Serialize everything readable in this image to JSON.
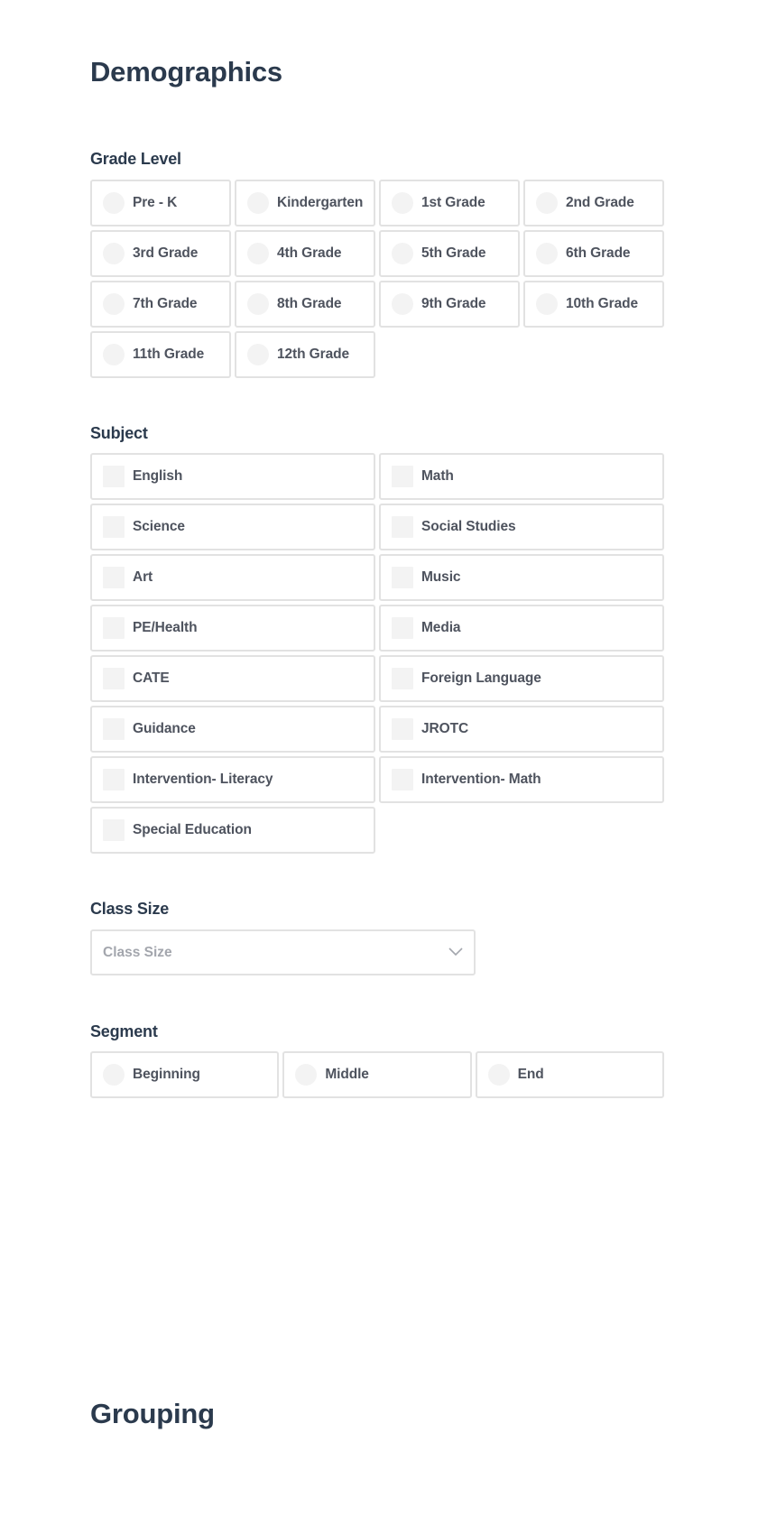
{
  "demographics": {
    "title": "Demographics",
    "grade_level": {
      "label": "Grade Level",
      "options": [
        "Pre - K",
        "Kindergarten",
        "1st Grade",
        "2nd Grade",
        "3rd Grade",
        "4th Grade",
        "5th Grade",
        "6th Grade",
        "7th Grade",
        "8th Grade",
        "9th Grade",
        "10th Grade",
        "11th Grade",
        "12th Grade"
      ]
    },
    "subject": {
      "label": "Subject",
      "options": [
        "English",
        "Math",
        "Science",
        "Social Studies",
        "Art",
        "Music",
        "PE/Health",
        "Media",
        "CATE",
        "Foreign Language",
        "Guidance",
        "JROTC",
        "Intervention- Literacy",
        "Intervention- Math",
        "Special Education"
      ]
    },
    "class_size": {
      "label": "Class Size",
      "placeholder": "Class Size",
      "icon": "chevron-down-icon"
    },
    "segment": {
      "label": "Segment",
      "options": [
        "Beginning",
        "Middle",
        "End"
      ]
    }
  },
  "grouping": {
    "title": "Grouping"
  },
  "colors": {
    "heading": "#2b3a4d",
    "option_text": "#4e535e",
    "border": "#e2e2e2",
    "control_fill": "#f3f3f3",
    "placeholder": "#a3a6ad"
  }
}
